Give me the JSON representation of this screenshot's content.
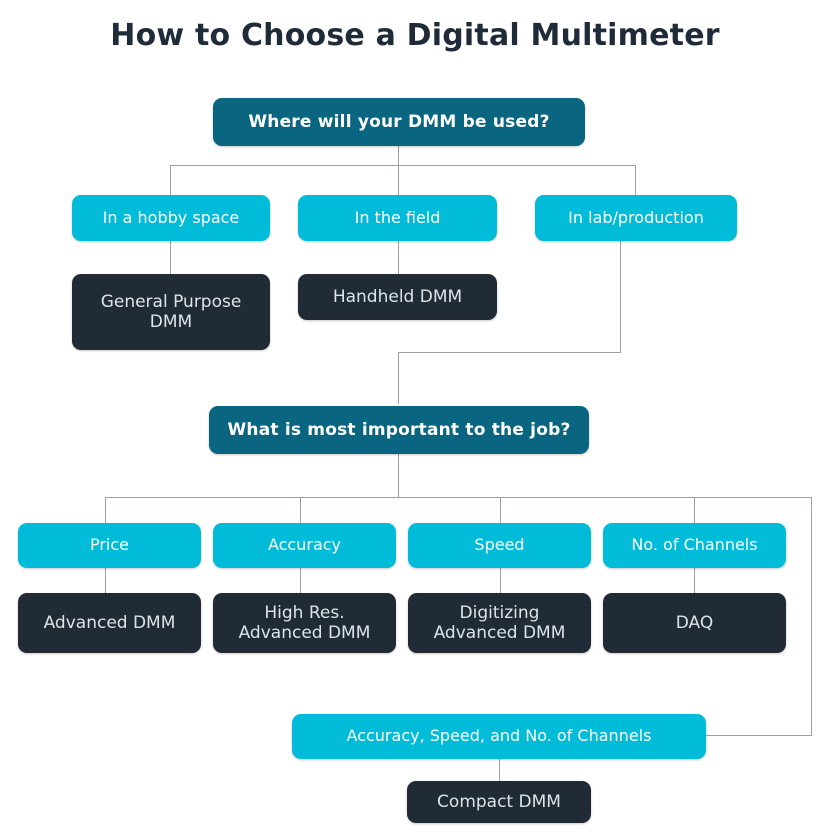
{
  "title": "How to Choose a Digital Multimeter",
  "colors": {
    "background": "#ffffff",
    "title_text": "#1f2b38",
    "question_box": "#0a6581",
    "question_text": "#ffffff",
    "choice_box": "#00bcd9",
    "choice_text": "#ffffff",
    "result_box": "#202b36",
    "result_text": "#dde3e8",
    "connector_line": "#9aa0a6"
  },
  "flowchart": {
    "type": "decision-tree",
    "question1": {
      "label": "Where will your DMM be used?",
      "kind": "question"
    },
    "question1_choices": [
      {
        "label": "In a hobby space",
        "kind": "choice"
      },
      {
        "label": "In the field",
        "kind": "choice"
      },
      {
        "label": "In lab/production",
        "kind": "choice"
      }
    ],
    "question1_results": [
      {
        "label": "General Purpose\nDMM",
        "kind": "result"
      },
      {
        "label": "Handheld DMM",
        "kind": "result"
      }
    ],
    "question2": {
      "label": "What is most important to the job?",
      "kind": "question"
    },
    "question2_choices": [
      {
        "label": "Price",
        "kind": "choice"
      },
      {
        "label": "Accuracy",
        "kind": "choice"
      },
      {
        "label": "Speed",
        "kind": "choice"
      },
      {
        "label": "No. of Channels",
        "kind": "choice"
      }
    ],
    "question2_results": [
      {
        "label": "Advanced DMM",
        "kind": "result"
      },
      {
        "label": "High Res.\nAdvanced DMM",
        "kind": "result"
      },
      {
        "label": "Digitizing\nAdvanced DMM",
        "kind": "result"
      },
      {
        "label": "DAQ",
        "kind": "result"
      }
    ],
    "combined_choice": {
      "label": "Accuracy, Speed, and No. of Channels",
      "kind": "choice"
    },
    "combined_result": {
      "label": "Compact DMM",
      "kind": "result"
    }
  }
}
